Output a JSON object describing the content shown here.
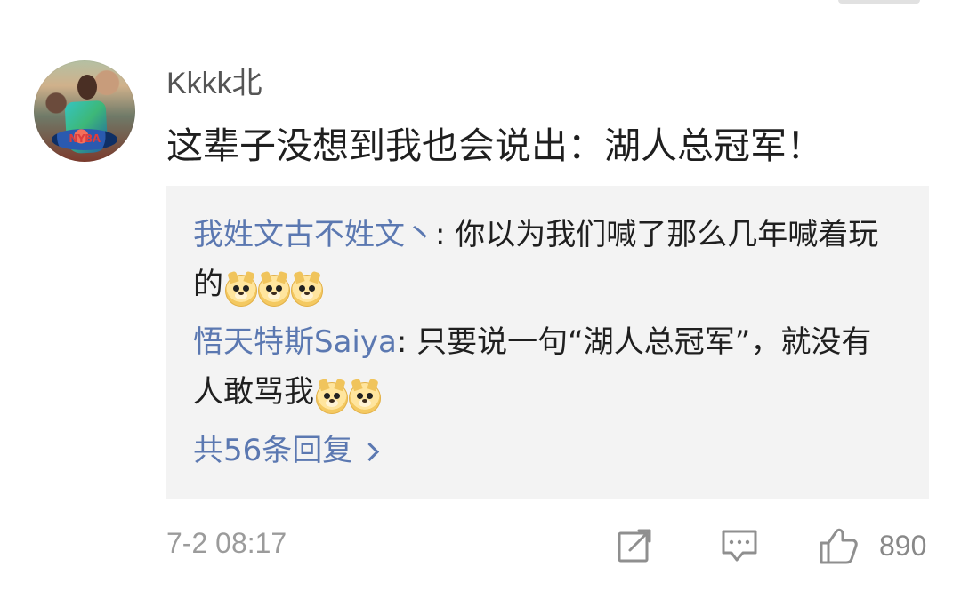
{
  "comment": {
    "username": "Kkkk北",
    "text": "这辈子没想到我也会说出：湖人总冠军！",
    "timestamp": "7-2 08:17"
  },
  "replies": [
    {
      "name": "我姓文古不姓文丶",
      "text": ": 你以为我们喊了那么几年喊着玩的",
      "emoji": [
        "doge",
        "doge",
        "doge"
      ]
    },
    {
      "name": "悟天特斯Saiya",
      "text": ": 只要说一句“湖人总冠军”，就没有人敢骂我",
      "emoji": [
        "doge",
        "doge"
      ]
    }
  ],
  "more_replies": {
    "label": "共56条回复"
  },
  "actions": {
    "like_count": "890"
  },
  "icons": {
    "share": "share-icon",
    "comment": "comment-icon",
    "like": "thumbs-up-icon",
    "more": "chevron-right-icon",
    "emoji": "doge-icon"
  },
  "colors": {
    "background": "#ffffff",
    "reply_box": "#f3f3f3",
    "reply_name": "#5b78b1",
    "primary_text": "#1f1f1f",
    "muted_text": "#9b9b9b"
  }
}
